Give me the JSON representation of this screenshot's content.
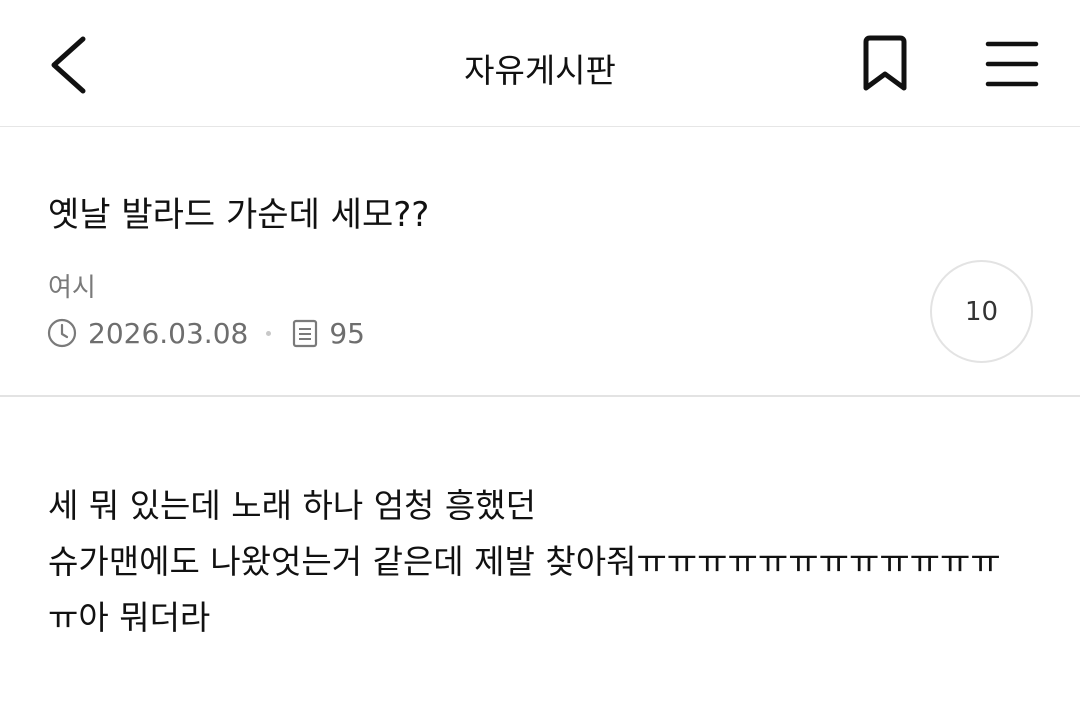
{
  "header": {
    "title": "자유게시판",
    "back_icon": "chevron-left-icon",
    "bookmark_icon": "bookmark-icon",
    "menu_icon": "hamburger-menu-icon"
  },
  "post": {
    "title": "옛날 발라드 가순데 세모??",
    "author": "여시",
    "date": "2026.03.08",
    "views": "95",
    "comment_count": "10",
    "body_lines": [
      "세 뭐 있는데 노래 하나 엄청 흥했던",
      "슈가맨에도 나왔엇는거 같은데 제발 찾아줘ㅠㅠㅠㅠㅠㅠㅠㅠㅠㅠㅠㅠ",
      "ㅠ아 뭐더라"
    ]
  },
  "colors": {
    "text": "#111111",
    "meta": "#6e6e6e",
    "divider": "#e3e3e3"
  }
}
